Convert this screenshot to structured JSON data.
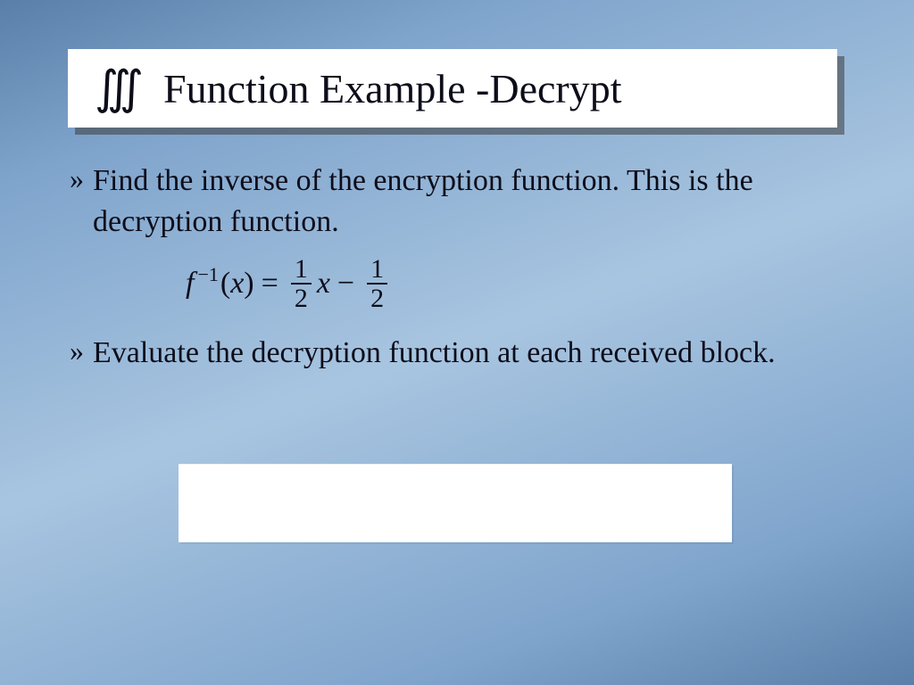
{
  "title": {
    "bullet": "∭",
    "text": "Function Example -Decrypt"
  },
  "bullets": [
    {
      "marker": "»",
      "text": "Find the inverse of the encryption function. This is the decryption function."
    },
    {
      "marker": "»",
      "text": "Evaluate the decryption function at each received block."
    }
  ],
  "formula": {
    "func": "f",
    "exponent": "−1",
    "arg_open": "(",
    "arg_var": "x",
    "arg_close": ")",
    "eq": "=",
    "frac1_num": "1",
    "frac1_den": "2",
    "mid_var": "x",
    "minus": "−",
    "frac2_num": "1",
    "frac2_den": "2"
  }
}
